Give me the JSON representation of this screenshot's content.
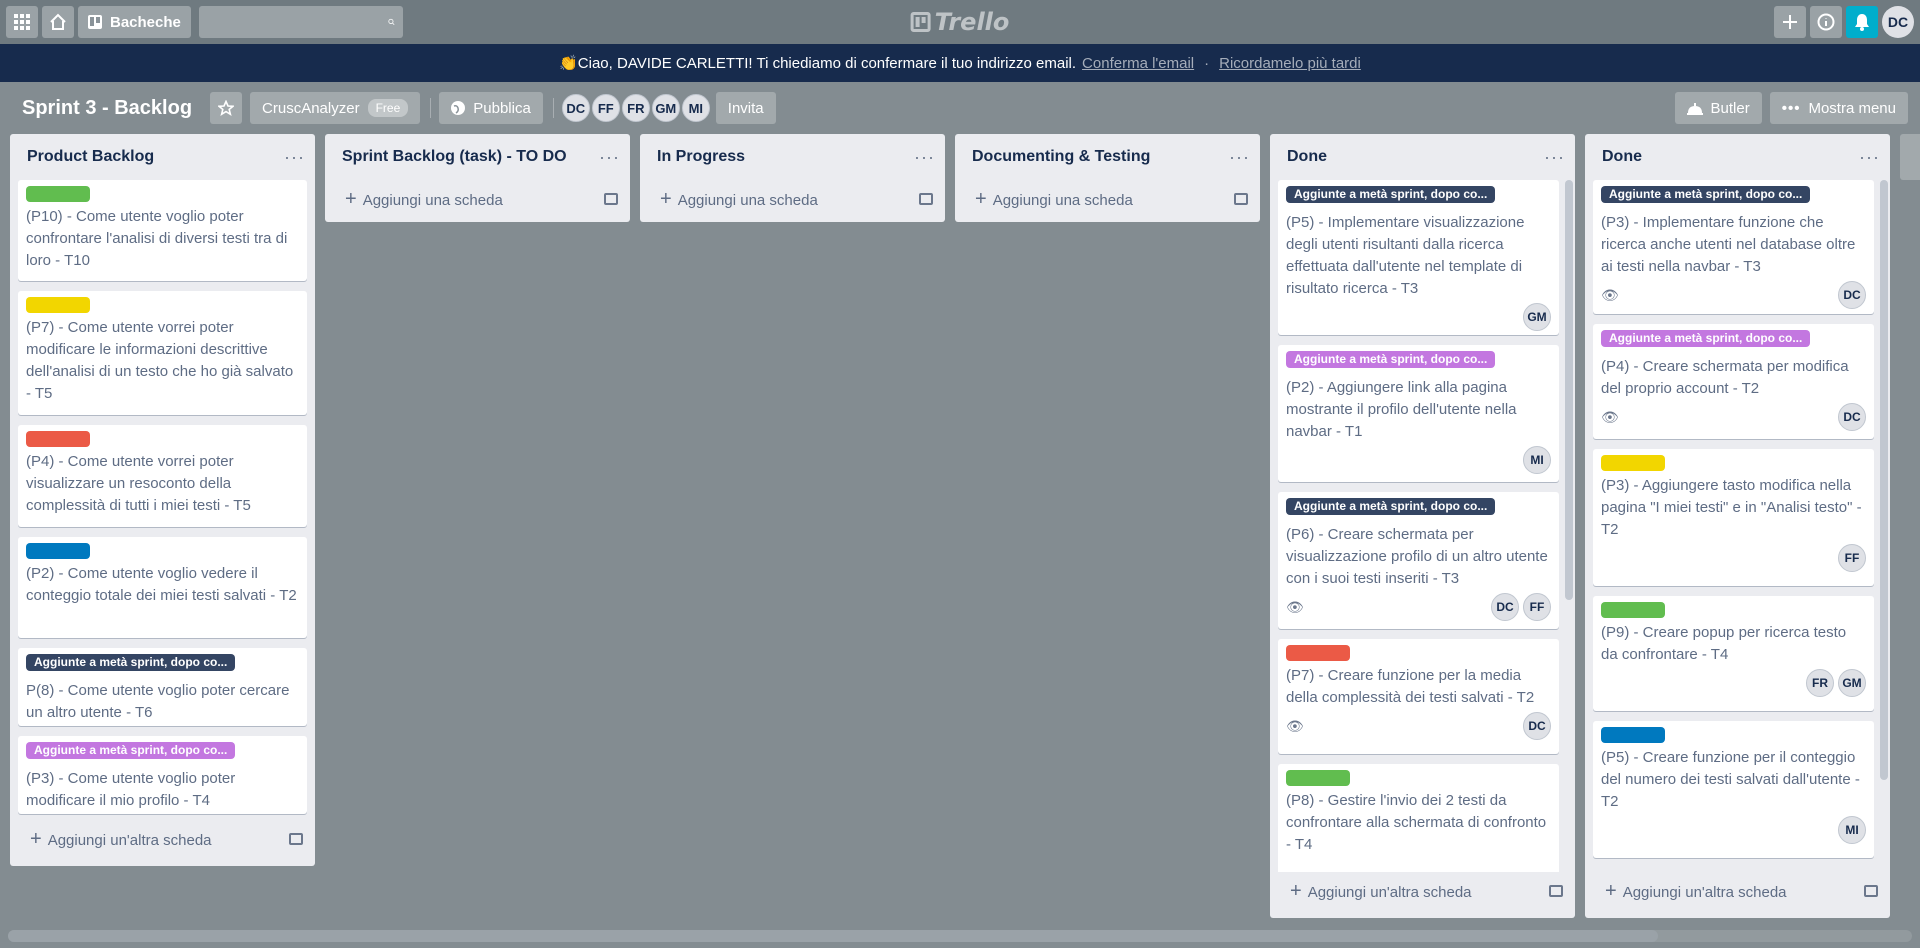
{
  "header": {
    "boards_label": "Bacheche",
    "search_placeholder": "",
    "logo_text": "Trello",
    "user_initials": "DC"
  },
  "banner": {
    "message": "👏Ciao, DAVIDE CARLETTI! Ti chiediamo di confermare il tuo indirizzo email.",
    "confirm_link": "Conferma l'email",
    "separator": "·",
    "remind_link": "Ricordamelo più tardi"
  },
  "board": {
    "title": "Sprint 3 - Backlog",
    "team_name": "CruscAnalyzer",
    "team_badge": "Free",
    "visibility": "Pubblica",
    "members": [
      "DC",
      "FF",
      "FR",
      "GM",
      "MI"
    ],
    "invite_label": "Invita",
    "butler_label": "Butler",
    "menu_label": "Mostra menu"
  },
  "colors": {
    "green": "#61bd4f",
    "yellow": "#f2d600",
    "red": "#eb5a46",
    "blue": "#0079bf",
    "navy": "#344563",
    "purple": "#c377e0"
  },
  "label_text_mid_sprint": "Aggiunte a metà sprint, dopo co...",
  "lists": [
    {
      "title": "Product Backlog",
      "add_label": "Aggiungi un'altra scheda",
      "cards": [
        {
          "label": "green",
          "text": "(P10) - Come utente voglio poter confrontare l'analisi di diversi testi tra di loro - T10"
        },
        {
          "label": "yellow",
          "text": "(P7) - Come utente vorrei poter modificare le informazioni descrittive dell'analisi di un testo che ho già salvato - T5"
        },
        {
          "label": "red",
          "text": "(P4) - Come utente vorrei poter visualizzare un resoconto della complessità di tutti i miei testi - T5"
        },
        {
          "label": "blue",
          "text": "(P2) - Come utente voglio vedere il conteggio totale dei miei testi salvati - T2"
        },
        {
          "label": "navy",
          "text": "P(8) - Come utente voglio poter cercare un altro utente - T6"
        },
        {
          "label": "purple",
          "text": "(P3) - Come utente voglio poter modificare il mio profilo - T4"
        }
      ]
    },
    {
      "title": "Sprint Backlog (task) - TO DO",
      "add_label": "Aggiungi una scheda",
      "cards": []
    },
    {
      "title": "In Progress",
      "add_label": "Aggiungi una scheda",
      "cards": []
    },
    {
      "title": "Documenting & Testing",
      "add_label": "Aggiungi una scheda",
      "cards": []
    },
    {
      "title": "Done",
      "add_label": "Aggiungi un'altra scheda",
      "cards": [
        {
          "label": "navy",
          "text": "(P5) - Implementare visualizzazione degli utenti risultanti dalla ricerca effettuata dall'utente nel template di risultato ricerca - T3",
          "members": [
            "GM"
          ]
        },
        {
          "label": "purple",
          "text": "(P2) - Aggiungere link alla pagina mostrante il profilo dell'utente nella navbar - T1",
          "members": [
            "MI"
          ]
        },
        {
          "label": "navy",
          "text": "(P6) - Creare schermata per visualizzazione profilo di un altro utente con i suoi testi inseriti - T3",
          "watch": true,
          "members": [
            "DC",
            "FF"
          ]
        },
        {
          "label": "red",
          "text": "(P7) - Creare funzione per la media della complessità dei testi salvati - T2",
          "watch": true,
          "members": [
            "DC"
          ]
        },
        {
          "label": "green",
          "text": "(P8) - Gestire l'invio dei 2 testi da confrontare alla schermata di confronto - T4",
          "members": []
        }
      ]
    },
    {
      "title": "Done",
      "add_label": "Aggiungi un'altra scheda",
      "cards": [
        {
          "label": "navy",
          "text": "(P3) - Implementare funzione che ricerca anche utenti nel database oltre ai testi nella navbar - T3",
          "watch": true,
          "members": [
            "DC"
          ]
        },
        {
          "label": "purple",
          "text": "(P4) - Creare schermata per modifica del proprio account - T2",
          "watch": true,
          "members": [
            "DC"
          ]
        },
        {
          "label": "yellow",
          "text": "(P3) - Aggiungere tasto modifica nella pagina \"I miei testi\" e in \"Analisi testo\" - T2",
          "members": [
            "FF"
          ]
        },
        {
          "label": "green",
          "text": "(P9) - Creare popup per ricerca testo da confrontare - T4",
          "members": [
            "FR",
            "GM"
          ]
        },
        {
          "label": "blue",
          "text": "(P5) - Creare funzione per il conteggio del numero dei testi salvati dall'utente - T2",
          "members": [
            "MI"
          ]
        }
      ]
    }
  ]
}
